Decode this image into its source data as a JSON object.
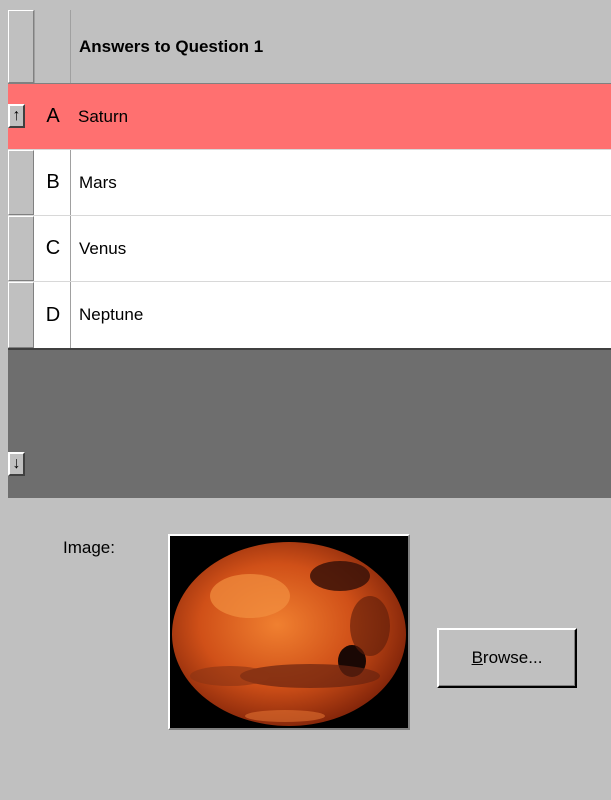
{
  "grid": {
    "header": "Answers to Question 1",
    "selected_letter": "A",
    "rows": [
      {
        "letter": "A",
        "answer": "Saturn"
      },
      {
        "letter": "B",
        "answer": "Mars"
      },
      {
        "letter": "C",
        "answer": "Venus"
      },
      {
        "letter": "D",
        "answer": "Neptune"
      }
    ]
  },
  "colors": {
    "selected_row": "#ff7070",
    "empty_area": "#6e6e6e",
    "panel": "#c0c0c0"
  },
  "image_section": {
    "label": "Image:",
    "image_name": "mars-planet-image",
    "browse_label": "Browse..."
  },
  "icons": {
    "move_up": "up-arrow-icon",
    "move_down": "down-arrow-icon"
  }
}
